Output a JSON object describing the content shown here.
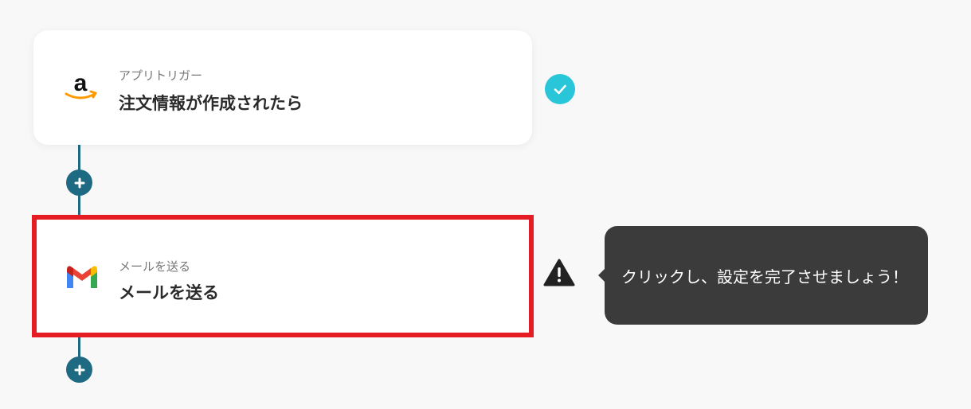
{
  "flow": {
    "trigger": {
      "app_icon": "amazon-logo-icon",
      "subtitle": "アプリトリガー",
      "title": "注文情報が作成されたら",
      "status_icon": "check-icon"
    },
    "action": {
      "app_icon": "gmail-logo-icon",
      "subtitle": "メールを送る",
      "title": "メールを送る",
      "status_icon": "warning-icon"
    },
    "add_step_icon": "plus-icon"
  },
  "tooltip": {
    "text": "クリックし、設定を完了させましょう！"
  },
  "colors": {
    "background": "#f8f8f8",
    "connector": "#1e6a82",
    "check": "#29c6d9",
    "highlight_border": "#e51c23",
    "tooltip_bg": "#3b3b3b",
    "amazon_orange": "#ff9900"
  }
}
